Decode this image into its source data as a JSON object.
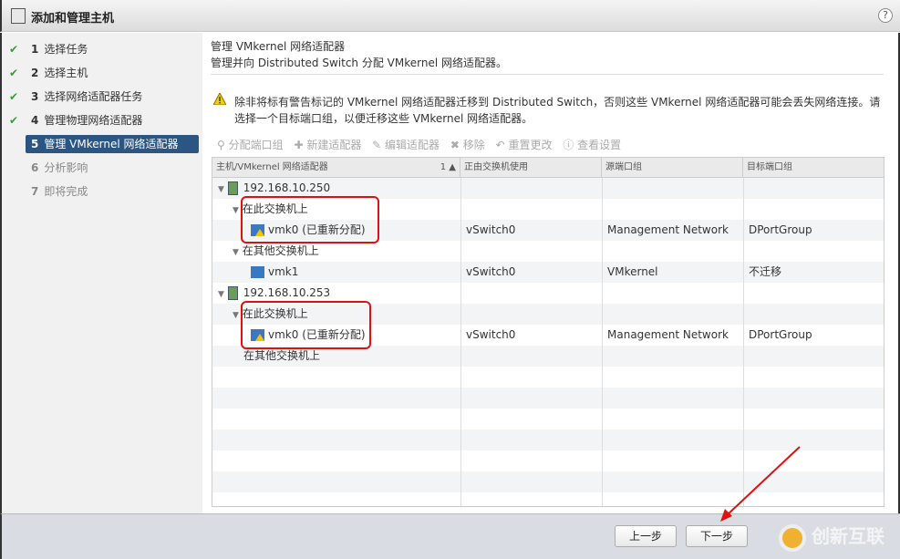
{
  "window": {
    "title": "添加和管理主机",
    "help": "?"
  },
  "steps": [
    {
      "num": "1",
      "label": "选择任务",
      "state": "done"
    },
    {
      "num": "2",
      "label": "选择主机",
      "state": "done"
    },
    {
      "num": "3",
      "label": "选择网络适配器任务",
      "state": "done"
    },
    {
      "num": "4",
      "label": "管理物理网络适配器",
      "state": "done"
    },
    {
      "num": "5",
      "label": "管理 VMkernel 网络适配器",
      "state": "active"
    },
    {
      "num": "6",
      "label": "分析影响",
      "state": "disabled"
    },
    {
      "num": "7",
      "label": "即将完成",
      "state": "disabled"
    }
  ],
  "main": {
    "title": "管理 VMkernel 网络适配器",
    "subtitle": "管理并向 Distributed Switch 分配 VMkernel 网络适配器。",
    "warning": "除非将标有警告标记的 VMkernel 网络适配器迁移到 Distributed Switch，否则这些 VMkernel 网络适配器可能会丢失网络连接。请选择一个目标端口组，以便迁移这些 VMkernel 网络适配器。",
    "toolbar": [
      "分配端口组",
      "新建适配器",
      "编辑适配器",
      "移除",
      "重置更改",
      "查看设置"
    ],
    "columns": [
      "主机/VMkernel 网络适配器",
      "正由交换机使用",
      "源端口组",
      "目标端口组"
    ],
    "sort_indicator": "1 ▲",
    "rows": [
      {
        "level": 0,
        "type": "host",
        "name": "192.168.10.250",
        "switch": "",
        "source": "",
        "target": ""
      },
      {
        "level": 1,
        "type": "group",
        "name": "在此交换机上",
        "switch": "",
        "source": "",
        "target": ""
      },
      {
        "level": 2,
        "type": "vmk-warn",
        "name": "vmk0 (已重新分配)",
        "switch": "vSwitch0",
        "source": "Management Network",
        "target": "DPortGroup"
      },
      {
        "level": 1,
        "type": "group",
        "name": "在其他交换机上",
        "switch": "",
        "source": "",
        "target": ""
      },
      {
        "level": 2,
        "type": "vmk",
        "name": "vmk1",
        "switch": "vSwitch0",
        "source": "VMkernel",
        "target": "不迁移"
      },
      {
        "level": 0,
        "type": "host",
        "name": "192.168.10.253",
        "switch": "",
        "source": "",
        "target": ""
      },
      {
        "level": 1,
        "type": "group",
        "name": "在此交换机上",
        "switch": "",
        "source": "",
        "target": ""
      },
      {
        "level": 2,
        "type": "vmk-warn",
        "name": "vmk0 (已重新分配)",
        "switch": "vSwitch0",
        "source": "Management Network",
        "target": "DPortGroup"
      },
      {
        "level": 1,
        "type": "group-noexp",
        "name": "在其他交换机上",
        "switch": "",
        "source": "",
        "target": ""
      }
    ]
  },
  "footer": {
    "back": "上一步",
    "next": "下一步"
  },
  "watermark": {
    "text": "创新互联"
  },
  "colors": {
    "active_step": "#2b5582",
    "highlight": "#dd1111"
  }
}
